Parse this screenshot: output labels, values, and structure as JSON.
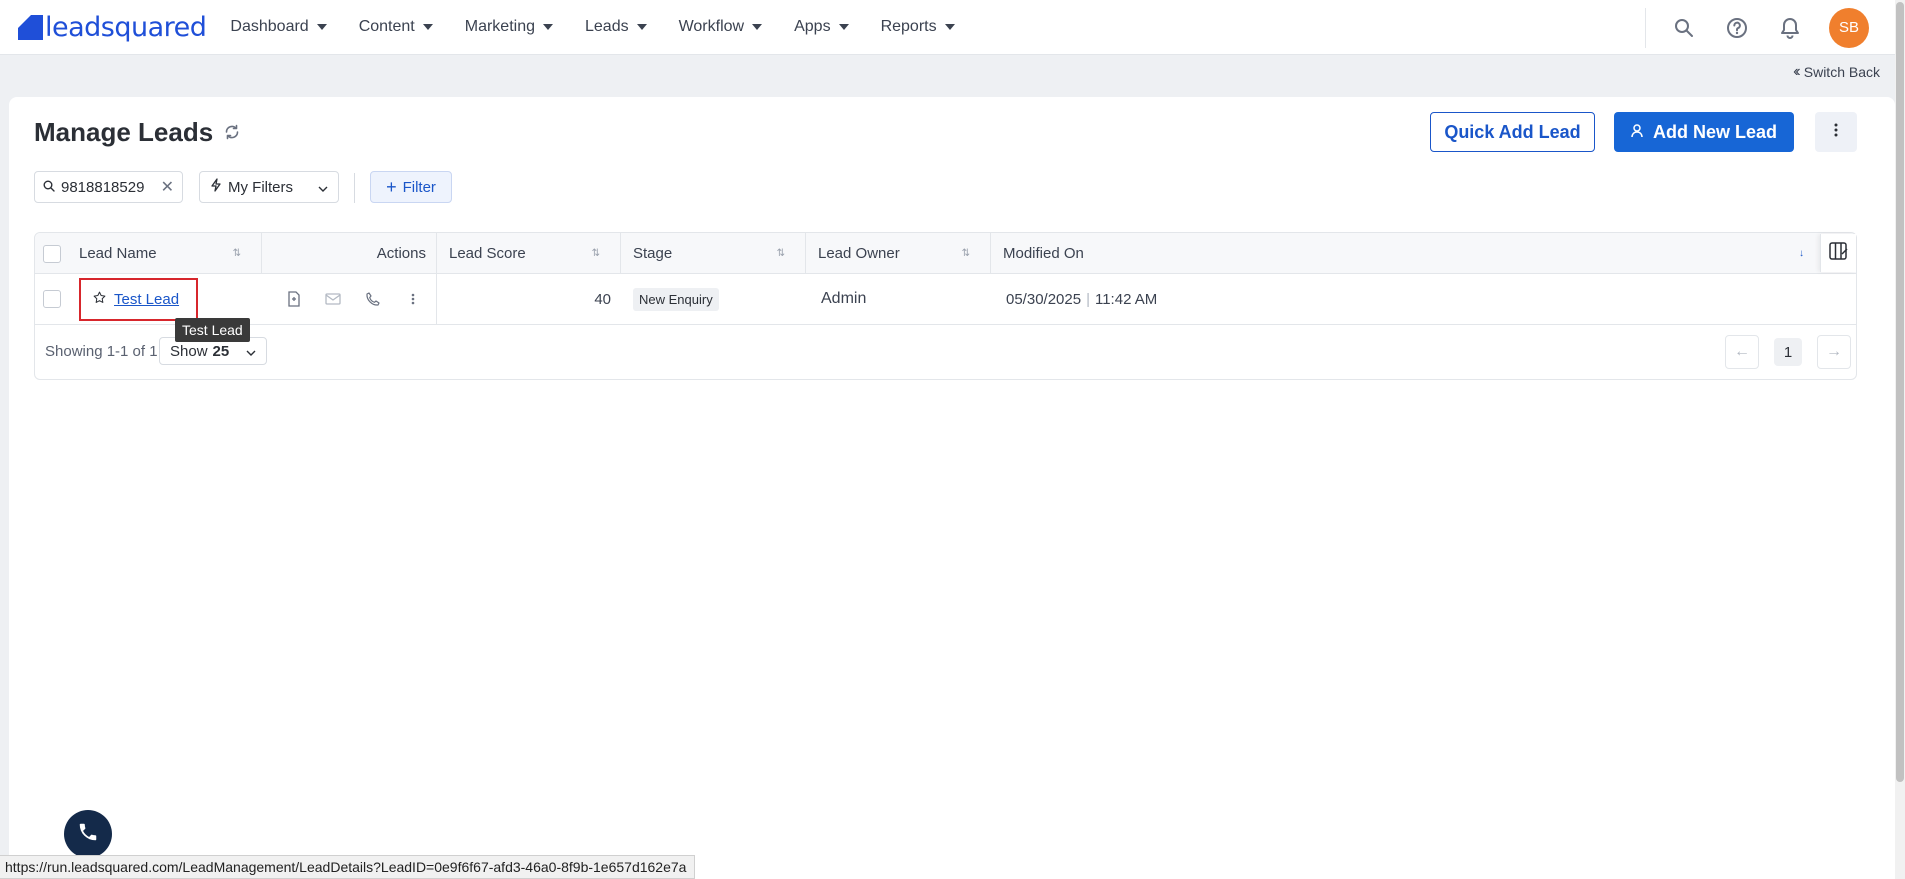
{
  "brand": {
    "logo_text": "leadsquared",
    "accent": "#1766d6",
    "avatar_color": "#f07f2d"
  },
  "nav": {
    "items": [
      {
        "label": "Dashboard"
      },
      {
        "label": "Content"
      },
      {
        "label": "Marketing"
      },
      {
        "label": "Leads"
      },
      {
        "label": "Workflow"
      },
      {
        "label": "Apps"
      },
      {
        "label": "Reports"
      }
    ],
    "icons": [
      "search-icon",
      "help-icon",
      "bell-icon"
    ],
    "avatar_initials": "SB"
  },
  "switch_back": {
    "label": "Switch Back"
  },
  "page": {
    "title": "Manage Leads",
    "quick_add_label": "Quick Add Lead",
    "add_new_label": "Add New Lead"
  },
  "filters": {
    "search_value": "9818818529",
    "my_filters_label": "My Filters",
    "filter_label": "Filter"
  },
  "table": {
    "columns": [
      "Lead Name",
      "Actions",
      "Lead Score",
      "Stage",
      "Lead Owner",
      "Modified On"
    ],
    "rows": [
      {
        "lead_name": "Test Lead",
        "lead_score": "40",
        "stage": "New Enquiry",
        "lead_owner": "Admin",
        "modified_date": "05/30/2025",
        "modified_time": "11:42 AM"
      }
    ],
    "tooltip": "Test Lead"
  },
  "pagination": {
    "showing_text": "Showing 1-1 of 1",
    "show_label": "Show",
    "page_size": "25",
    "current_page": "1"
  },
  "status_url": "https://run.leadsquared.com/LeadManagement/LeadDetails?LeadID=0e9f6f67-afd3-46a0-8f9b-1e657d162e7a"
}
